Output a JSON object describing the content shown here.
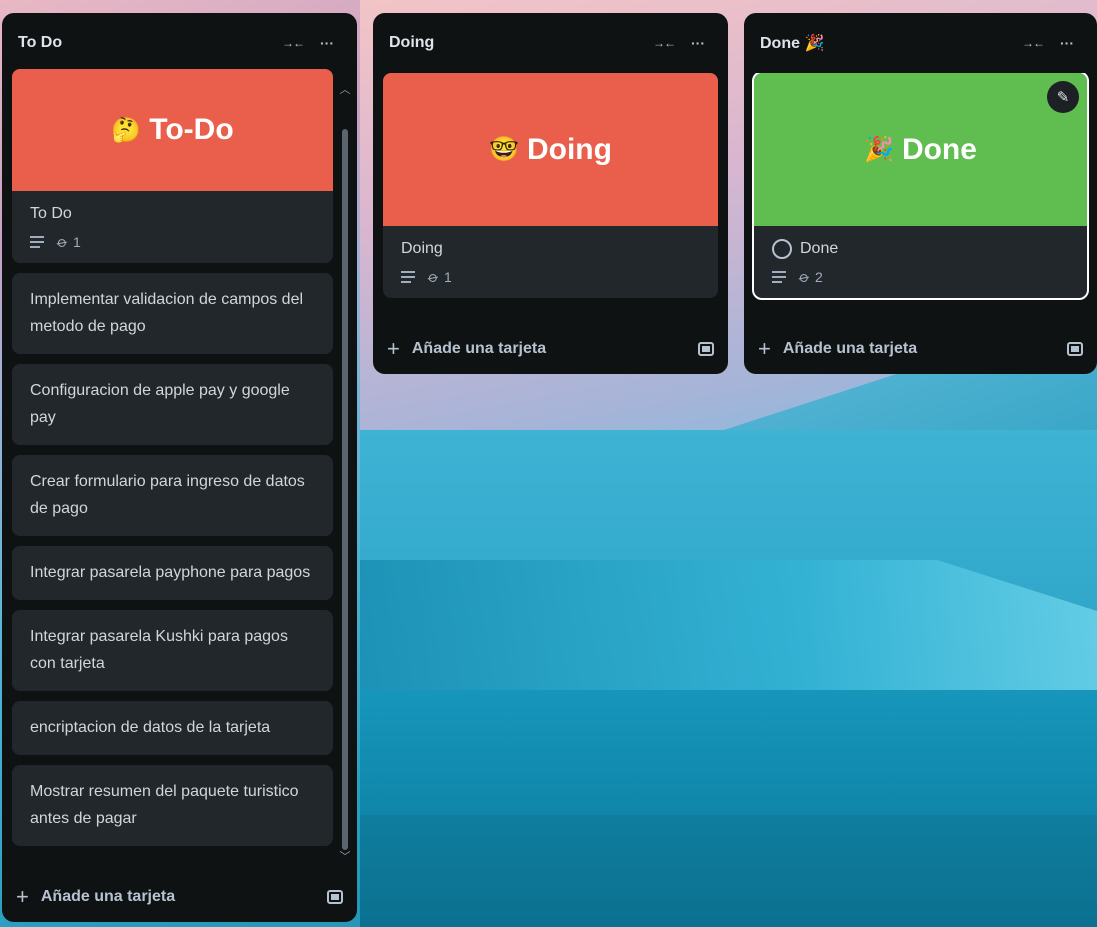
{
  "lists": [
    {
      "title": "To Do",
      "collapse_icon": "→←",
      "menu_icon": "···",
      "cover_card": {
        "cover_color": "#e95f4b",
        "cover_emoji": "🤔",
        "cover_text": "To-Do",
        "title": "To Do",
        "attachments": "1"
      },
      "cards": [
        "Implementar validacion de campos del metodo de pago",
        "Configuracion de apple pay y google pay",
        "Crear formulario para ingreso de datos de pago",
        "Integrar pasarela payphone para pagos",
        "Integrar pasarela Kushki para pagos con tarjeta",
        "encriptacion de datos de la tarjeta",
        "Mostrar resumen del paquete turistico antes de pagar"
      ],
      "add_card": "Añade una tarjeta"
    },
    {
      "title": "Doing",
      "collapse_icon": "→←",
      "menu_icon": "···",
      "cover_card": {
        "cover_color": "#e95f4b",
        "cover_emoji": "🤓",
        "cover_text": "Doing",
        "title": "Doing",
        "attachments": "1"
      },
      "add_card": "Añade una tarjeta"
    },
    {
      "title": "Done 🎉",
      "collapse_icon": "→←",
      "menu_icon": "···",
      "cover_card": {
        "cover_color": "#60bd4f",
        "cover_emoji": "🎉",
        "cover_text": "Done",
        "title": "Done",
        "attachments": "2"
      },
      "add_card": "Añade una tarjeta"
    }
  ]
}
